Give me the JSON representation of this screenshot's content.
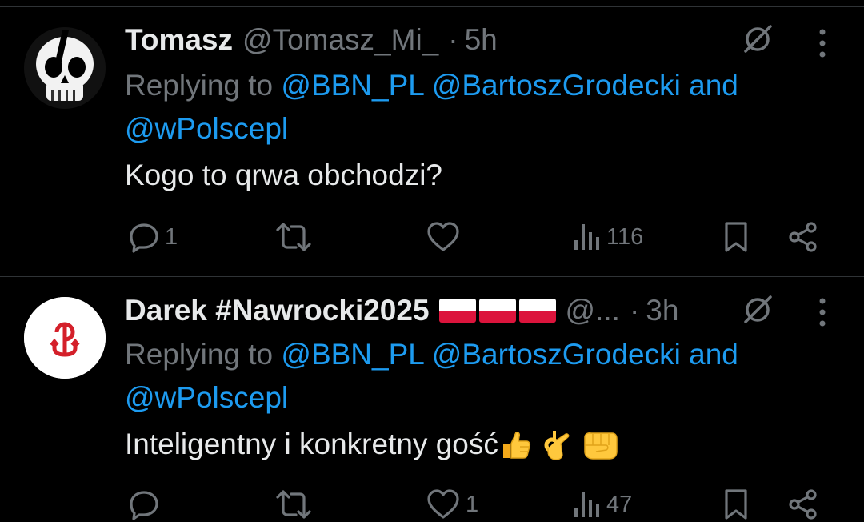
{
  "tweets": [
    {
      "author_name": "Tomasz",
      "handle": "@Tomasz_Mi_",
      "dot": "·",
      "time": "5h",
      "replying_prefix": "Replying to",
      "mentions": [
        "@BBN_PL",
        "@BartoszGrodecki",
        "@wPolscepl"
      ],
      "and_word": "and",
      "text": "Kogo to qrwa obchodzi?",
      "replies": "1",
      "reposts": "",
      "likes": "",
      "views": "116"
    },
    {
      "author_name": "Darek #Nawrocki2025",
      "handle": "@...",
      "dot": "·",
      "time": "3h",
      "replying_prefix": "Replying to",
      "mentions": [
        "@BBN_PL",
        "@BartoszGrodecki",
        "@wPolscepl"
      ],
      "and_word": "and",
      "text": "Inteligentny i konkretny gość",
      "replies": "",
      "reposts": "",
      "likes": "1",
      "views": "47"
    }
  ],
  "colors": {
    "background": "#000000",
    "text": "#e7e9ea",
    "muted": "#71767b",
    "link": "#1d9bf0",
    "divider": "#2f3336"
  },
  "icons": [
    "grok-icon",
    "more-icon",
    "reply-icon",
    "repost-icon",
    "like-icon",
    "views-icon",
    "bookmark-icon",
    "share-icon",
    "poland-flag-icon",
    "thumbs-up-emoji",
    "ok-hand-emoji",
    "fist-emoji",
    "kotwica-icon",
    "skull-icon"
  ]
}
